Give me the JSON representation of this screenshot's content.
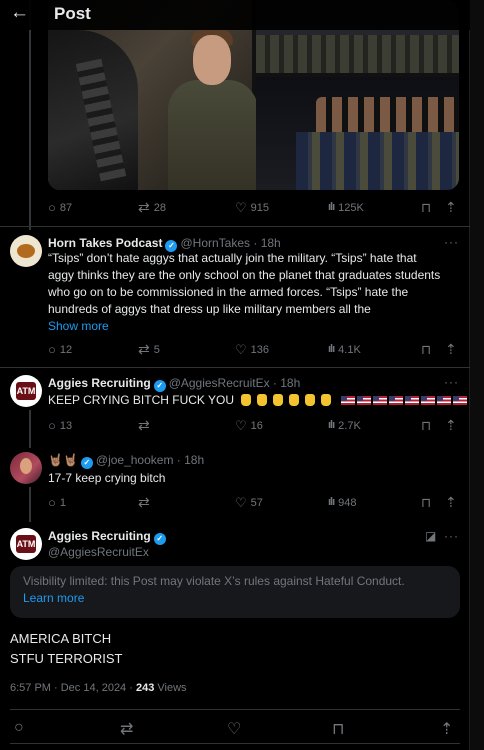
{
  "header": {
    "back_icon": "arrow-left-icon",
    "title": "Post"
  },
  "tweet0": {
    "stats": {
      "replies": "87",
      "retweets": "28",
      "likes": "915",
      "views": "125K"
    }
  },
  "tweet1": {
    "name": "Horn Takes Podcast",
    "handle": "@HornTakes · 18h",
    "lines": [
      "“Tsips” don’t hate aggys that actually join the military. “Tsips” hate that",
      "aggy thinks they are the only school on the planet that graduates students",
      "who go on to be commissioned in the armed forces. “Tsips” hate the",
      "hundreds of aggys that dress up like military members all the"
    ],
    "show_more": "Show more",
    "stats": {
      "replies": "12",
      "retweets": "5",
      "likes": "136",
      "views": "4.1K"
    }
  },
  "tweet2": {
    "name": "Aggies Recruiting",
    "handle": "@AggiesRecruitEx · 18h",
    "text": "KEEP CRYING BITCH FUCK YOU",
    "stats": {
      "replies": "13",
      "retweets": "",
      "likes": "16",
      "views": "2.7K"
    }
  },
  "tweet3": {
    "name": "🤘🏽🤘🏽",
    "handle": "@joe_hookem · 18h",
    "text": "17-7 keep crying bitch",
    "stats": {
      "replies": "1",
      "retweets": "",
      "likes": "57",
      "views": "948"
    }
  },
  "main": {
    "name": "Aggies Recruiting",
    "handle": "@AggiesRecruitEx",
    "notice_text": "Visibility limited: this Post may violate X’s rules against Hateful Conduct.",
    "notice_link": "Learn more",
    "line1": "AMERICA BITCH",
    "line2": "STFU TERRORIST",
    "timestamp": "6:57 PM · Dec 14, 2024 · ",
    "views_count": "243",
    "views_label": " Views"
  },
  "colors": {
    "background": "#000000",
    "text": "#e7e9ea",
    "muted": "#71767b",
    "accent": "#1d9bf0",
    "divider": "#2f3336"
  }
}
